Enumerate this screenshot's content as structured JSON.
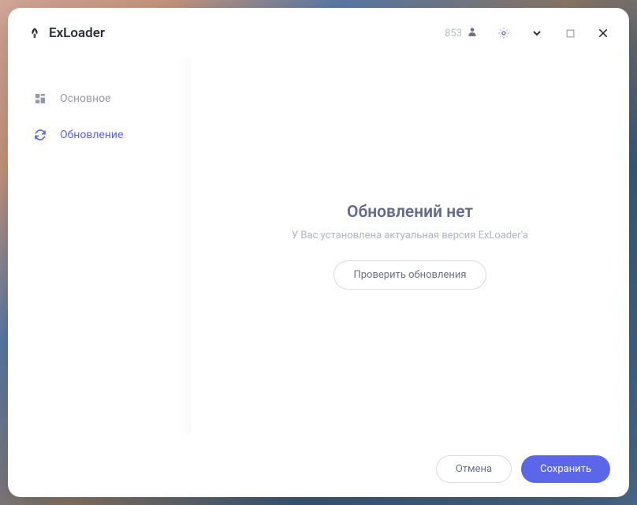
{
  "app": {
    "title": "ExLoader"
  },
  "titlebar": {
    "user_count": "853"
  },
  "sidebar": {
    "items": [
      {
        "label": "Основное",
        "active": false
      },
      {
        "label": "Обновление",
        "active": true
      }
    ]
  },
  "main": {
    "title": "Обновлений нет",
    "subtitle": "У Вас установлена актуальная версия ExLoader'а",
    "check_button": "Проверить обновления"
  },
  "footer": {
    "cancel": "Отмена",
    "save": "Сохранить"
  },
  "colors": {
    "accent": "#5b67e8"
  }
}
